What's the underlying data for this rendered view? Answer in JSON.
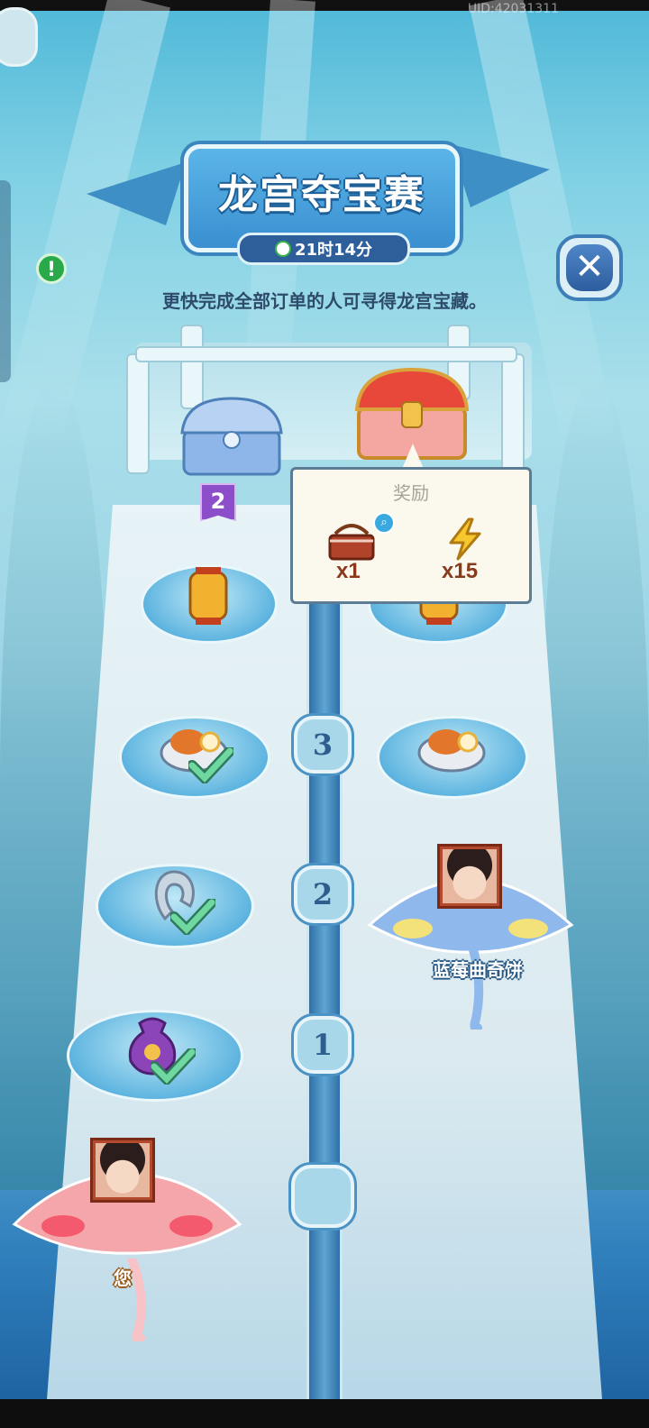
{
  "status_bar": {
    "uid_text": "UID:42031311"
  },
  "header": {
    "title": "龙宫夺宝赛",
    "timer": "21时14分",
    "description": "更快完成全部订单的人可寻得龙宫宝藏。"
  },
  "chests": {
    "blue_chest_rank": "2"
  },
  "reward_popup": {
    "title": "奖励",
    "items": [
      {
        "icon": "picnic-basket-icon",
        "qty": "x1"
      },
      {
        "icon": "energy-bolt-icon",
        "qty": "x15"
      }
    ]
  },
  "track": {
    "nodes": [
      "3",
      "2",
      "1"
    ]
  },
  "players": {
    "opponent_name": "蓝莓曲奇饼",
    "self_name": "您"
  },
  "colors": {
    "accent_blue": "#3a8fd0",
    "pink_ray": "#f4a6aa",
    "blue_ray": "#8fb9ec",
    "check_green": "#4fc37a"
  }
}
